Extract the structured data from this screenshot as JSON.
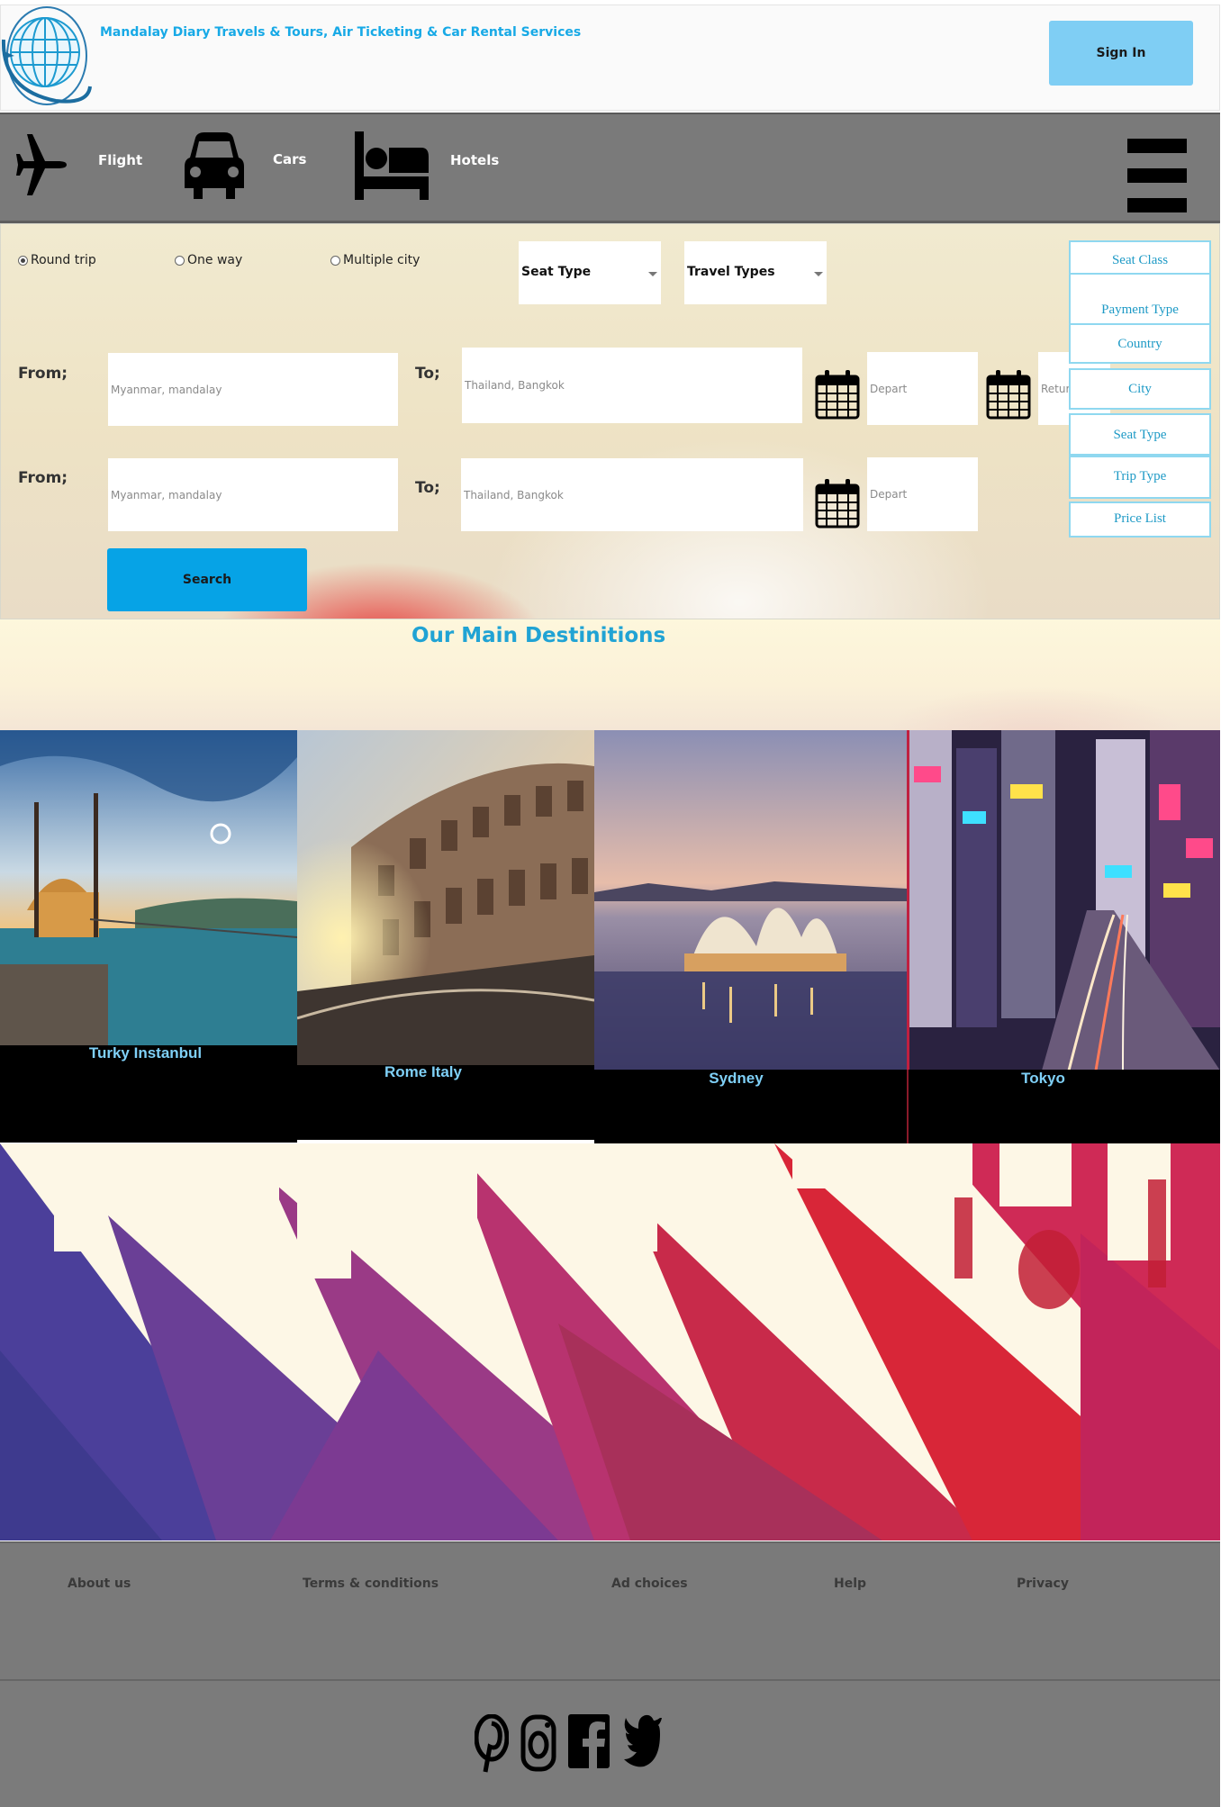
{
  "header": {
    "title": "Mandalay Diary Travels & Tours, Air Ticketing & Car Rental Services",
    "signin_label": "Sign In"
  },
  "nav": {
    "items": [
      {
        "label": "Flight",
        "icon": "airplane-icon"
      },
      {
        "label": "Cars",
        "icon": "car-icon"
      },
      {
        "label": "Hotels",
        "icon": "bed-icon"
      }
    ],
    "menu_icon": "hamburger-menu-icon"
  },
  "search": {
    "trip_options": [
      {
        "label": "Round trip",
        "checked": true
      },
      {
        "label": "One way",
        "checked": false
      },
      {
        "label": "Multiple city",
        "checked": false
      }
    ],
    "seat_type_select": "Seat Type",
    "travel_types_select": "Travel Types",
    "row1": {
      "from_label": "From;",
      "from_placeholder": "Myanmar, mandalay",
      "to_label": "To;",
      "to_placeholder": "Thailand, Bangkok",
      "depart_placeholder": "Depart",
      "return_placeholder": "Return"
    },
    "row2": {
      "from_label": "From;",
      "from_placeholder": "Myanmar, mandalay",
      "to_label": "To;",
      "to_placeholder": "Thailand, Bangkok",
      "depart_placeholder": "Depart"
    },
    "search_label": "Search"
  },
  "side_menu": [
    "Seat Class",
    "Payment Type",
    "Country",
    "City",
    "Seat Type",
    "Trip Type",
    "Price List"
  ],
  "destinations": {
    "title": "Our Main Destinitions",
    "cards": [
      "Turky Instanbul",
      "Rome Italy",
      "Sydney",
      "Tokyo"
    ]
  },
  "footer": {
    "links": [
      "About us",
      "Terms & conditions",
      "Ad choices",
      "Help",
      "Privacy"
    ],
    "social_icons": [
      "pinterest-icon",
      "instagram-icon",
      "facebook-icon",
      "twitter-icon"
    ]
  },
  "colors": {
    "accent": "#17a9e6",
    "signin_bg": "#7fcef4",
    "search_btn": "#06a3e6",
    "nav_bg": "#7a7a7a",
    "caption_text": "#7fd0f7"
  }
}
